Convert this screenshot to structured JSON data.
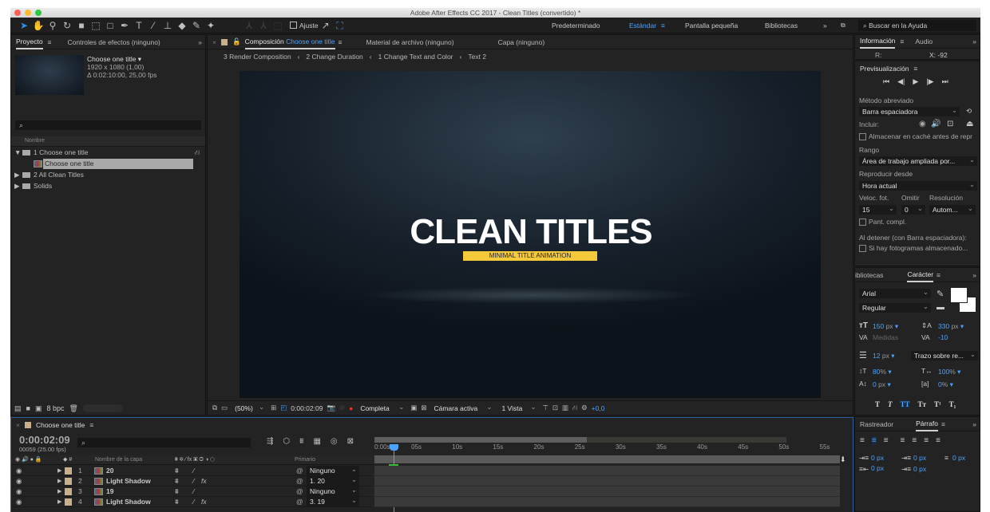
{
  "app": {
    "title": "Adobe After Effects CC 2017 - Clean Titles (convertido) *"
  },
  "toolbar": {
    "snapping_label": "Ajuste",
    "workspaces": [
      "Predeterminado",
      "Estándar",
      "Pantalla pequeña",
      "Bibliotecas"
    ],
    "active_workspace": "Estándar",
    "search_placeholder": "Buscar en la Ayuda"
  },
  "project": {
    "tabs": [
      "Proyecto",
      "Controles de efectos (ninguno)"
    ],
    "item_name": "Choose one title ▾",
    "item_size": "1920 x 1080 (1,00)",
    "item_duration": "Δ 0:02:10:00, 25,00 fps",
    "column_name": "Nombre",
    "items": [
      {
        "label": "1 Choose one title",
        "type": "folder",
        "expanded": true
      },
      {
        "label": "Choose one title",
        "type": "comp",
        "selected": true
      },
      {
        "label": "2 All Clean Titles",
        "type": "folder"
      },
      {
        "label": "Solids",
        "type": "folder"
      }
    ],
    "bpc": "8 bpc"
  },
  "composition": {
    "tab_prefix": "Composición",
    "tab_name": "Choose one title",
    "other_tabs": [
      "Material de archivo (ninguno)",
      "Capa (ninguno)"
    ],
    "breadcrumbs": [
      "3 Render Composition",
      "2 Change Duration",
      "1 Change Text and Color",
      "Text 2"
    ],
    "title_text": "CLEAN TITLES",
    "subtitle_text": "MINIMAL TITLE ANIMATION",
    "accent_color": "#f5c93a"
  },
  "viewer_bar": {
    "zoom": "(50%)",
    "timecode": "0:00:02:09",
    "resolution": "Completa",
    "camera": "Cámara activa",
    "views": "1 Vista",
    "exposure": "+0,0"
  },
  "info": {
    "tabs": [
      "Información",
      "Audio"
    ],
    "r_label": "R:",
    "x_label": "X: -92"
  },
  "preview": {
    "title": "Previsualización",
    "shortcut_label": "Método abreviado",
    "shortcut_value": "Barra espaciadora",
    "include_label": "Incluir:",
    "cache_label": "Almacenar en caché antes de repr",
    "range_label": "Rango",
    "range_value": "Área de trabajo ampliada por...",
    "play_from_label": "Reproducir desde",
    "play_from_value": "Hora actual",
    "fps_label": "Veloc. fot.",
    "skip_label": "Omitir",
    "res_label": "Resolución",
    "fps_value": "15",
    "skip_value": "0",
    "res_value": "Autom...",
    "fullscreen_label": "Pant. compl.",
    "on_stop_label": "Al detener (con Barra espaciadora):",
    "on_stop_option": "Si hay fotogramas almacenado..."
  },
  "character": {
    "tabs": [
      "ibliotecas",
      "Carácter"
    ],
    "font": "Arial",
    "style": "Regular",
    "size": "150",
    "size_unit": "px",
    "leading": "330",
    "leading_unit": "px",
    "kerning": "Medidas",
    "tracking": "-10",
    "stroke": "12",
    "stroke_unit": "px",
    "stroke_mode": "Trazo sobre re...",
    "vscale": "80",
    "vscale_unit": "%",
    "hscale": "100",
    "hscale_unit": "%",
    "baseline": "0",
    "baseline_unit": "px",
    "tsume": "0",
    "tsume_unit": "%",
    "styles": [
      "T",
      "T",
      "TT",
      "Tт",
      "T¹",
      "T₁"
    ]
  },
  "paragraph": {
    "tabs": [
      "Rastreador",
      "Párrafo"
    ],
    "indent_left": "0 px",
    "indent_first": "0 px",
    "indent_right": "0 px",
    "space_before": "0 px",
    "space_after": "0 px"
  },
  "timeline": {
    "comp_name": "Choose one title",
    "timecode": "0:00:02:09",
    "frames": "00059 (25.00 fps)",
    "col_layer_name": "Nombre de la capa",
    "col_parent": "Primario",
    "ruler": [
      "0:00s",
      "05s",
      "10s",
      "15s",
      "20s",
      "25s",
      "30s",
      "35s",
      "40s",
      "45s",
      "50s",
      "55s"
    ],
    "playhead_seconds": 2.36,
    "work_area_end_seconds": 26,
    "layers": [
      {
        "num": "1",
        "name": "20",
        "fx": false,
        "parent": "Ninguno"
      },
      {
        "num": "2",
        "name": "Light Shadow",
        "fx": true,
        "parent": "1. 20"
      },
      {
        "num": "3",
        "name": "19",
        "fx": false,
        "parent": "Ninguno"
      },
      {
        "num": "4",
        "name": "Light Shadow",
        "fx": true,
        "parent": "3. 19"
      }
    ]
  }
}
